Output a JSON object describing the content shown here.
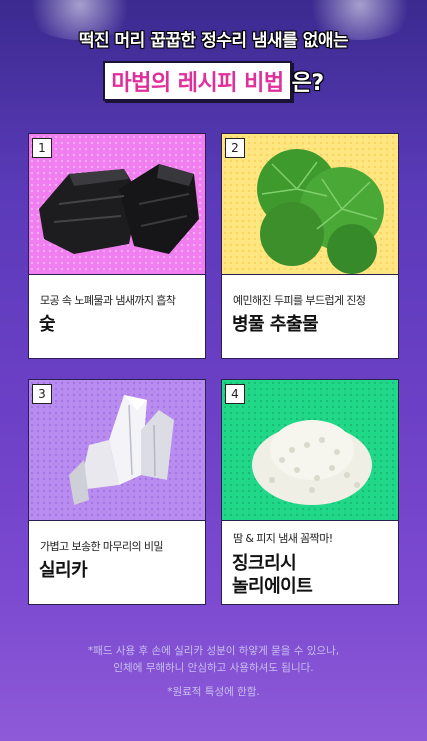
{
  "header": {
    "line1": "떡진 머리 꿉꿉한 정수리 냄새를 없애는",
    "highlight": "마법의 레시피 비법",
    "tail": "은?"
  },
  "cards": [
    {
      "number": "1",
      "subtitle": "모공 속 노폐물과 냄새까지 흡착",
      "title": "숯",
      "icon": "charcoal-image"
    },
    {
      "number": "2",
      "subtitle": "예민해진 두피를 부드럽게 진정",
      "title": "병풀 추출물",
      "icon": "centella-leaf-image"
    },
    {
      "number": "3",
      "subtitle": "가볍고 보송한 마무리의 비밀",
      "title": "실리카",
      "icon": "silica-crystal-image"
    },
    {
      "number": "4",
      "subtitle": "땀 & 피지 냄새 꼼짝마!",
      "title_line1": "징크리시",
      "title_line2": "놀리에이트",
      "icon": "granules-image"
    }
  ],
  "footer": {
    "note1": "*패드 사용 후 손에 실리카 성분이 하얗게 묻을 수 있으나,",
    "note2": "인체에 무해하니 안심하고 사용하셔도 됩니다.",
    "note3": "*원료적 특성에 한함."
  },
  "colors": {
    "card1_bg": "#f07ef0",
    "card2_bg": "#ffe680",
    "card3_bg": "#b98cf0",
    "card4_bg": "#21d889",
    "highlight_text": "#e02f9a"
  }
}
